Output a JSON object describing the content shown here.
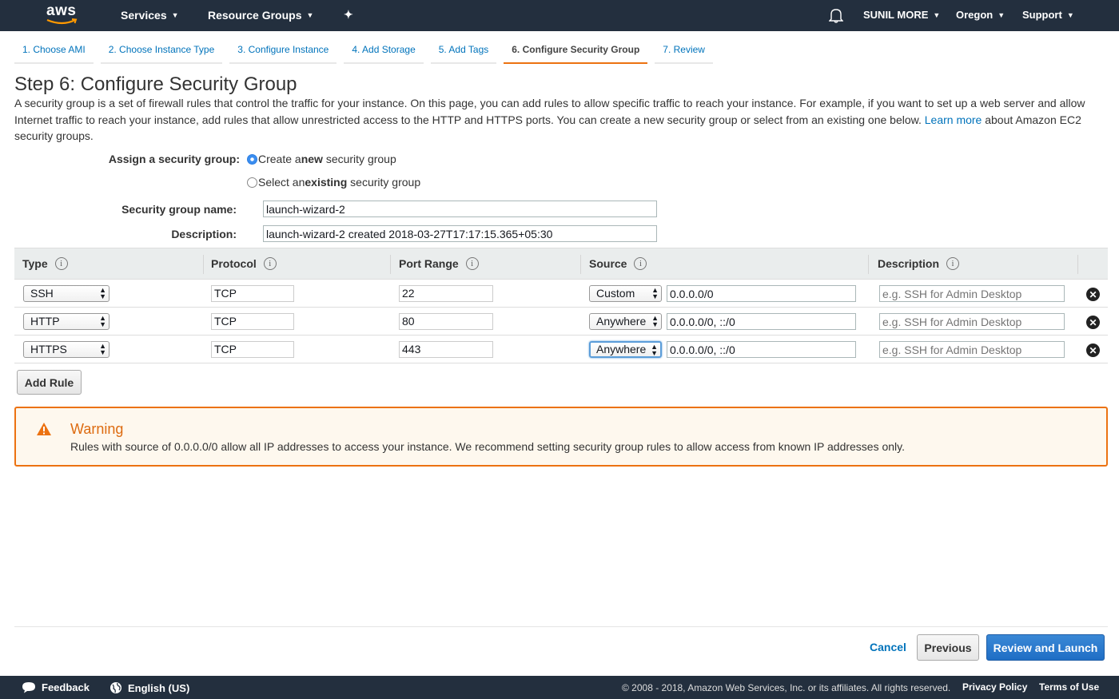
{
  "topnav": {
    "logo": "aws",
    "services": "Services",
    "resource_groups": "Resource Groups",
    "user": "SUNIL MORE",
    "region": "Oregon",
    "support": "Support",
    "icons": [
      "pin-icon",
      "bell-icon"
    ]
  },
  "tabs": [
    {
      "label": "1. Choose AMI",
      "active": false
    },
    {
      "label": "2. Choose Instance Type",
      "active": false
    },
    {
      "label": "3. Configure Instance",
      "active": false
    },
    {
      "label": "4. Add Storage",
      "active": false
    },
    {
      "label": "5. Add Tags",
      "active": false
    },
    {
      "label": "6. Configure Security Group",
      "active": true
    },
    {
      "label": "7. Review",
      "active": false
    }
  ],
  "page": {
    "title": "Step 6: Configure Security Group",
    "intro_a": "A security group is a set of firewall rules that control the traffic for your instance. On this page, you can add rules to allow specific traffic to reach your instance. For example, if you want to set up a web server and allow Internet traffic to reach your instance, add rules that allow unrestricted access to the HTTP and HTTPS ports. You can create a new security group or select from an existing one below. ",
    "learn_more": "Learn more",
    "intro_b": " about Amazon EC2 security groups."
  },
  "form": {
    "assign_label": "Assign a security group:",
    "option_new_a": "Create a ",
    "option_new_b": "new",
    "option_new_c": " security group",
    "option_existing_a": "Select an ",
    "option_existing_b": "existing",
    "option_existing_c": " security group",
    "selected_option": "new",
    "name_label": "Security group name:",
    "name_value": "launch-wizard-2",
    "desc_label": "Description:",
    "desc_value": "launch-wizard-2 created 2018-03-27T17:17:15.365+05:30"
  },
  "table": {
    "headers": {
      "type": "Type",
      "protocol": "Protocol",
      "port_range": "Port Range",
      "source": "Source",
      "description": "Description"
    },
    "rows": [
      {
        "type": "SSH",
        "protocol": "TCP",
        "port": "22",
        "source_type": "Custom",
        "source_value": "0.0.0.0/0",
        "desc_placeholder": "e.g. SSH for Admin Desktop"
      },
      {
        "type": "HTTP",
        "protocol": "TCP",
        "port": "80",
        "source_type": "Anywhere",
        "source_value": "0.0.0.0/0, ::/0",
        "desc_placeholder": "e.g. SSH for Admin Desktop"
      },
      {
        "type": "HTTPS",
        "protocol": "TCP",
        "port": "443",
        "source_type": "Anywhere",
        "source_value": "0.0.0.0/0, ::/0",
        "desc_placeholder": "e.g. SSH for Admin Desktop"
      }
    ],
    "add_rule": "Add Rule"
  },
  "warning": {
    "title": "Warning",
    "text": "Rules with source of 0.0.0.0/0 allow all IP addresses to access your instance. We recommend setting security group rules to allow access from known IP addresses only."
  },
  "actions": {
    "cancel": "Cancel",
    "previous": "Previous",
    "review_launch": "Review and Launch"
  },
  "footer": {
    "feedback": "Feedback",
    "language": "English (US)",
    "copyright": "© 2008 - 2018, Amazon Web Services, Inc. or its affiliates. All rights reserved.",
    "privacy": "Privacy Policy",
    "terms": "Terms of Use"
  },
  "colors": {
    "accent": "#ec7211",
    "link": "#0073bb",
    "nav_bg": "#232f3e",
    "primary_button": "#1f6ec5",
    "warning_bg": "#fef8ee"
  }
}
